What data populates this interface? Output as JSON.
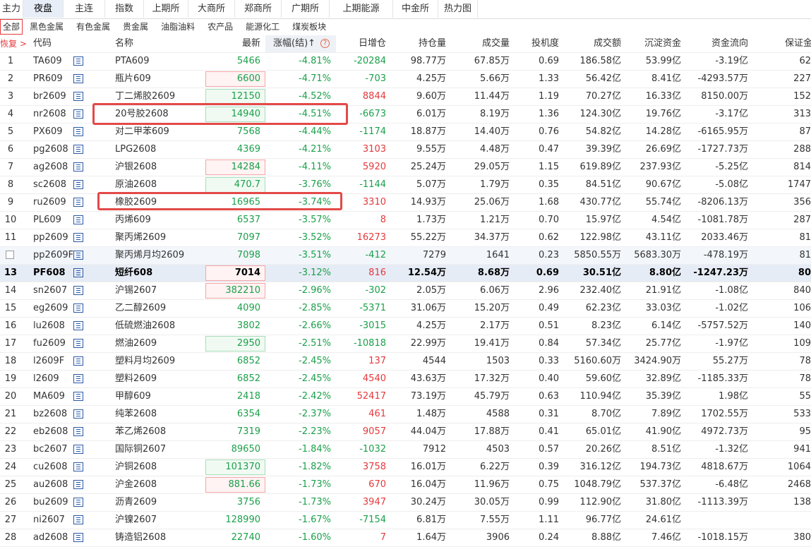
{
  "top_tabs": [
    {
      "label": "主力",
      "active": false
    },
    {
      "label": "夜盘",
      "active": true
    },
    {
      "label": "主连",
      "active": false
    },
    {
      "label": "指数",
      "active": false
    },
    {
      "label": "上期所",
      "active": false
    },
    {
      "label": "大商所",
      "active": false
    },
    {
      "label": "郑商所",
      "active": false
    },
    {
      "label": "广期所",
      "active": false
    },
    {
      "label": "上期能源",
      "active": false
    },
    {
      "label": "中金所",
      "active": false
    },
    {
      "label": "热力图",
      "active": false
    }
  ],
  "categories": [
    {
      "label": "全部",
      "active": true
    },
    {
      "label": "黑色金属",
      "active": false
    },
    {
      "label": "有色金属",
      "active": false
    },
    {
      "label": "贵金属",
      "active": false
    },
    {
      "label": "油脂油料",
      "active": false
    },
    {
      "label": "农产品",
      "active": false
    },
    {
      "label": "能源化工",
      "active": false
    },
    {
      "label": "煤炭板块",
      "active": false
    }
  ],
  "header": {
    "restore": "恢复 >",
    "code": "代码",
    "name": "名称",
    "last": "最新",
    "change": "涨幅(结)↑",
    "oi_change": "日增仓",
    "open_interest": "持仓量",
    "volume": "成交量",
    "speculation": "投机度",
    "turnover": "成交额",
    "capital": "沉淀资金",
    "flow": "资金流向",
    "margin": "保证金"
  },
  "colors": {
    "up": "#e4393c",
    "down": "#1ca04b",
    "annotation": "#e34948",
    "selected_row": "#e6ecf6"
  },
  "rows": [
    {
      "no": "1",
      "code": "TA609",
      "name": "PTA609",
      "last": "5466",
      "last_box": "",
      "chg": "-4.81%",
      "oi": "-20284",
      "oi_c": "green",
      "pos": "98.77万",
      "vol": "67.85万",
      "spec": "0.69",
      "amt": "186.58亿",
      "cap": "53.99亿",
      "flow": "-3.19亿",
      "margin": "62"
    },
    {
      "no": "2",
      "code": "PR609",
      "name": "瓶片609",
      "last": "6600",
      "last_box": "red",
      "chg": "-4.71%",
      "oi": "-703",
      "oi_c": "green",
      "pos": "4.25万",
      "vol": "5.66万",
      "spec": "1.33",
      "amt": "56.42亿",
      "cap": "8.41亿",
      "flow": "-4293.57万",
      "margin": "227"
    },
    {
      "no": "3",
      "code": "br2609",
      "name": "丁二烯胶2609",
      "last": "12150",
      "last_box": "green",
      "chg": "-4.52%",
      "oi": "8844",
      "oi_c": "red",
      "pos": "9.60万",
      "vol": "11.44万",
      "spec": "1.19",
      "amt": "70.27亿",
      "cap": "16.33亿",
      "flow": "8150.00万",
      "margin": "152"
    },
    {
      "no": "4",
      "code": "nr2608",
      "name": "20号胶2608",
      "last": "14940",
      "last_box": "green",
      "chg": "-4.51%",
      "oi": "-6673",
      "oi_c": "green",
      "pos": "6.01万",
      "vol": "8.19万",
      "spec": "1.36",
      "amt": "124.30亿",
      "cap": "19.76亿",
      "flow": "-3.17亿",
      "margin": "313"
    },
    {
      "no": "5",
      "code": "PX609",
      "name": "对二甲苯609",
      "last": "7568",
      "last_box": "",
      "chg": "-4.44%",
      "oi": "-1174",
      "oi_c": "green",
      "pos": "18.87万",
      "vol": "14.40万",
      "spec": "0.76",
      "amt": "54.82亿",
      "cap": "14.28亿",
      "flow": "-6165.95万",
      "margin": "87"
    },
    {
      "no": "6",
      "code": "pg2608",
      "name": "LPG2608",
      "last": "4369",
      "last_box": "",
      "chg": "-4.21%",
      "oi": "3103",
      "oi_c": "red",
      "pos": "9.55万",
      "vol": "4.48万",
      "spec": "0.47",
      "amt": "39.39亿",
      "cap": "26.69亿",
      "flow": "-1727.73万",
      "margin": "288"
    },
    {
      "no": "7",
      "code": "ag2608",
      "name": "沪银2608",
      "last": "14284",
      "last_box": "red",
      "chg": "-4.11%",
      "oi": "5920",
      "oi_c": "red",
      "pos": "25.24万",
      "vol": "29.05万",
      "spec": "1.15",
      "amt": "619.89亿",
      "cap": "237.93亿",
      "flow": "-5.25亿",
      "margin": "814"
    },
    {
      "no": "8",
      "code": "sc2608",
      "name": "原油2608",
      "last": "470.7",
      "last_box": "green",
      "chg": "-3.76%",
      "oi": "-1144",
      "oi_c": "green",
      "pos": "5.07万",
      "vol": "1.79万",
      "spec": "0.35",
      "amt": "84.51亿",
      "cap": "90.67亿",
      "flow": "-5.08亿",
      "margin": "1747"
    },
    {
      "no": "9",
      "code": "ru2609",
      "name": "橡胶2609",
      "last": "16965",
      "last_box": "",
      "chg": "-3.74%",
      "oi": "3310",
      "oi_c": "red",
      "pos": "14.93万",
      "vol": "25.06万",
      "spec": "1.68",
      "amt": "430.77亿",
      "cap": "55.74亿",
      "flow": "-8206.13万",
      "margin": "356"
    },
    {
      "no": "10",
      "code": "PL609",
      "name": "丙烯609",
      "last": "6537",
      "last_box": "",
      "chg": "-3.57%",
      "oi": "8",
      "oi_c": "red",
      "pos": "1.73万",
      "vol": "1.21万",
      "spec": "0.70",
      "amt": "15.97亿",
      "cap": "4.54亿",
      "flow": "-1081.78万",
      "margin": "287"
    },
    {
      "no": "11",
      "code": "pp2609",
      "name": "聚丙烯2609",
      "last": "7097",
      "last_box": "",
      "chg": "-3.52%",
      "oi": "16273",
      "oi_c": "red",
      "pos": "55.22万",
      "vol": "34.37万",
      "spec": "0.62",
      "amt": "122.98亿",
      "cap": "43.11亿",
      "flow": "2033.46万",
      "margin": "81"
    },
    {
      "no": "",
      "checkbox": true,
      "hl": true,
      "code": "pp2609F",
      "name": "聚丙烯月均2609",
      "last": "7098",
      "last_box": "",
      "chg": "-3.51%",
      "oi": "-412",
      "oi_c": "green",
      "pos": "7279",
      "vol": "1641",
      "spec": "0.23",
      "amt": "5850.55万",
      "cap": "5683.30万",
      "flow": "-478.19万",
      "margin": "81"
    },
    {
      "no": "13",
      "sel": true,
      "code": "PF608",
      "name": "短纤608",
      "last": "7014",
      "last_box": "red",
      "chg": "-3.12%",
      "oi": "816",
      "oi_c": "red",
      "pos": "12.54万",
      "vol": "8.68万",
      "spec": "0.69",
      "amt": "30.51亿",
      "cap": "8.80亿",
      "flow": "-1247.23万",
      "margin": "80"
    },
    {
      "no": "14",
      "code": "sn2607",
      "name": "沪锡2607",
      "last": "382210",
      "last_box": "red",
      "chg": "-2.96%",
      "oi": "-302",
      "oi_c": "green",
      "pos": "2.05万",
      "vol": "6.06万",
      "spec": "2.96",
      "amt": "232.40亿",
      "cap": "21.91亿",
      "flow": "-1.08亿",
      "margin": "840"
    },
    {
      "no": "15",
      "code": "eg2609",
      "name": "乙二醇2609",
      "last": "4090",
      "last_box": "",
      "chg": "-2.85%",
      "oi": "-5371",
      "oi_c": "green",
      "pos": "31.06万",
      "vol": "15.20万",
      "spec": "0.49",
      "amt": "62.23亿",
      "cap": "33.03亿",
      "flow": "-1.02亿",
      "margin": "106"
    },
    {
      "no": "16",
      "code": "lu2608",
      "name": "低硫燃油2608",
      "last": "3802",
      "last_box": "",
      "chg": "-2.66%",
      "oi": "-3015",
      "oi_c": "green",
      "pos": "4.25万",
      "vol": "2.17万",
      "spec": "0.51",
      "amt": "8.23亿",
      "cap": "6.14亿",
      "flow": "-5757.52万",
      "margin": "140"
    },
    {
      "no": "17",
      "code": "fu2609",
      "name": "燃油2609",
      "last": "2950",
      "last_box": "green",
      "chg": "-2.51%",
      "oi": "-10818",
      "oi_c": "green",
      "pos": "22.99万",
      "vol": "19.41万",
      "spec": "0.84",
      "amt": "57.34亿",
      "cap": "25.77亿",
      "flow": "-1.97亿",
      "margin": "109"
    },
    {
      "no": "18",
      "code": "l2609F",
      "name": "塑料月均2609",
      "last": "6852",
      "last_box": "",
      "chg": "-2.45%",
      "oi": "137",
      "oi_c": "red",
      "pos": "4544",
      "vol": "1503",
      "spec": "0.33",
      "amt": "5160.60万",
      "cap": "3424.90万",
      "flow": "55.27万",
      "margin": "78"
    },
    {
      "no": "19",
      "code": "l2609",
      "name": "塑料2609",
      "last": "6852",
      "last_box": "",
      "chg": "-2.45%",
      "oi": "4540",
      "oi_c": "red",
      "pos": "43.63万",
      "vol": "17.32万",
      "spec": "0.40",
      "amt": "59.60亿",
      "cap": "32.89亿",
      "flow": "-1185.33万",
      "margin": "78"
    },
    {
      "no": "20",
      "code": "MA609",
      "name": "甲醇609",
      "last": "2418",
      "last_box": "",
      "chg": "-2.42%",
      "oi": "52417",
      "oi_c": "red",
      "pos": "73.19万",
      "vol": "45.79万",
      "spec": "0.63",
      "amt": "110.94亿",
      "cap": "35.39亿",
      "flow": "1.98亿",
      "margin": "55"
    },
    {
      "no": "21",
      "code": "bz2608",
      "name": "纯苯2608",
      "last": "6354",
      "last_box": "",
      "chg": "-2.37%",
      "oi": "461",
      "oi_c": "red",
      "pos": "1.48万",
      "vol": "4588",
      "spec": "0.31",
      "amt": "8.70亿",
      "cap": "7.89亿",
      "flow": "1702.55万",
      "margin": "533"
    },
    {
      "no": "22",
      "code": "eb2608",
      "name": "苯乙烯2608",
      "last": "7319",
      "last_box": "",
      "chg": "-2.23%",
      "oi": "9057",
      "oi_c": "red",
      "pos": "44.04万",
      "vol": "17.88万",
      "spec": "0.41",
      "amt": "65.01亿",
      "cap": "41.90亿",
      "flow": "4972.73万",
      "margin": "95"
    },
    {
      "no": "23",
      "code": "bc2607",
      "name": "国际铜2607",
      "last": "89650",
      "last_box": "",
      "chg": "-1.84%",
      "oi": "-1032",
      "oi_c": "green",
      "pos": "7912",
      "vol": "4503",
      "spec": "0.57",
      "amt": "20.26亿",
      "cap": "8.51亿",
      "flow": "-1.32亿",
      "margin": "941"
    },
    {
      "no": "24",
      "code": "cu2608",
      "name": "沪铜2608",
      "last": "101370",
      "last_box": "green",
      "chg": "-1.82%",
      "oi": "3758",
      "oi_c": "red",
      "pos": "16.01万",
      "vol": "6.22万",
      "spec": "0.39",
      "amt": "316.12亿",
      "cap": "194.73亿",
      "flow": "4818.67万",
      "margin": "1064"
    },
    {
      "no": "25",
      "code": "au2608",
      "name": "沪金2608",
      "last": "881.66",
      "last_box": "red",
      "chg": "-1.73%",
      "oi": "670",
      "oi_c": "red",
      "pos": "16.04万",
      "vol": "11.96万",
      "spec": "0.75",
      "amt": "1048.79亿",
      "cap": "537.37亿",
      "flow": "-6.48亿",
      "margin": "2468"
    },
    {
      "no": "26",
      "code": "bu2609",
      "name": "沥青2609",
      "last": "3756",
      "last_box": "",
      "chg": "-1.73%",
      "oi": "3947",
      "oi_c": "red",
      "pos": "30.24万",
      "vol": "30.05万",
      "spec": "0.99",
      "amt": "112.90亿",
      "cap": "31.80亿",
      "flow": "-1113.39万",
      "margin": "138"
    },
    {
      "no": "27",
      "code": "ni2607",
      "name": "沪镍2607",
      "last": "128990",
      "last_box": "",
      "chg": "-1.67%",
      "oi": "-7154",
      "oi_c": "green",
      "pos": "6.81万",
      "vol": "7.55万",
      "spec": "1.11",
      "amt": "96.77亿",
      "cap": "24.61亿",
      "flow": "",
      "margin": ""
    },
    {
      "no": "28",
      "code": "ad2608",
      "name": "铸造铝2608",
      "last": "22740",
      "last_box": "",
      "chg": "-1.60%",
      "oi": "7",
      "oi_c": "red",
      "pos": "1.64万",
      "vol": "3906",
      "spec": "0.24",
      "amt": "8.88亿",
      "cap": "7.46亿",
      "flow": "-1018.15万",
      "margin": "380"
    }
  ]
}
